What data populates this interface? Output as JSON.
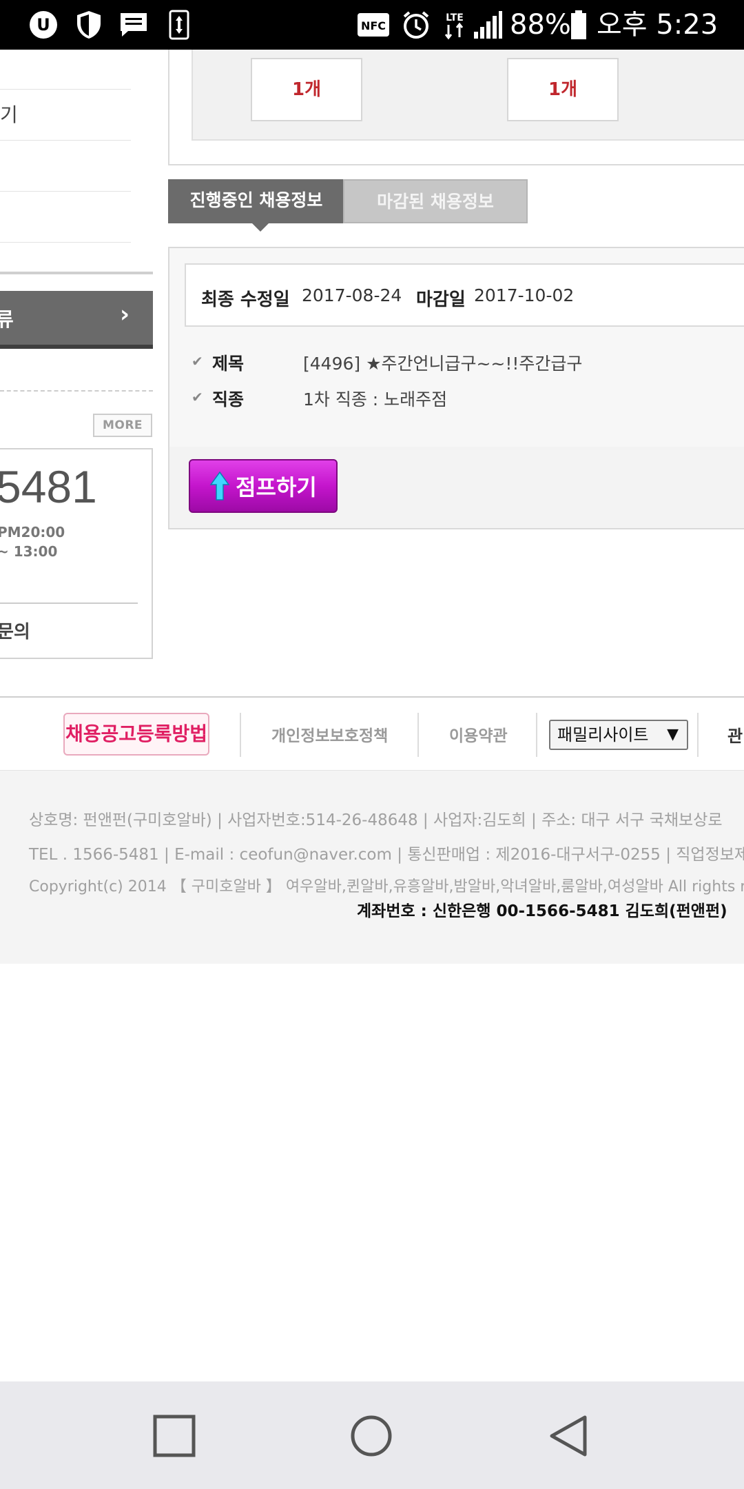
{
  "status_bar": {
    "battery_percent": "88%",
    "time": "오후 5:23",
    "nfc_label": "NFC",
    "lte_label": "LTE"
  },
  "sidebar": {
    "items": [
      "",
      "기",
      "",
      ""
    ],
    "dark_button_label": "류",
    "more_label": "MORE",
    "cs_phone": "5481",
    "cs_hours_1": "PM20:00",
    "cs_hours_2": "~ 13:00",
    "cs_line_3": ")",
    "cs_inquiry": "문의"
  },
  "main": {
    "counts": [
      "1개",
      "1개"
    ],
    "tabs": {
      "active": "진행중인 채용정보",
      "inactive": "마감된 채용정보"
    },
    "job": {
      "modified_label": "최종 수정일",
      "modified_date": "2017-08-24",
      "deadline_label": "마감일",
      "deadline_date": "2017-10-02",
      "title_label": "제목",
      "title_value": "[4496] ★주간언니급구~~!!주간급구",
      "category_label": "직종",
      "category_value": "1차 직종 : 노래주점",
      "jump_label": "점프하기"
    }
  },
  "footer_links": {
    "register_label": "채용공고등록방법",
    "privacy_label": "개인정보보호정책",
    "terms_label": "이용약관",
    "family_site_label": "패밀리사이트",
    "clipped_label": "관"
  },
  "company_info": {
    "line1": "상호명: 펀앤펀(구미호알바) | 사업자번호:514-26-48648 | 사업자:김도희 | 주소: 대구 서구 국채보상로",
    "line2": "TEL . 1566-5481 | E-mail : ceofun@naver.com | 통신판매업 : 제2016-대구서구-0255 | 직업정보제",
    "line3": "Copyright(c) 2014 【 구미호알바 】 여우알바,퀸알바,유흥알바,밤알바,악녀알바,룸알바,여성알바 All rights re",
    "bank": "계좌번호 : 신한은행 00-1566-5481 김도희(펀앤펀)"
  },
  "colors": {
    "count_red": "#c0272d",
    "jump_magenta": "#c415cc",
    "register_pink": "#e01f63",
    "tab_active": "#6b6b6b"
  }
}
